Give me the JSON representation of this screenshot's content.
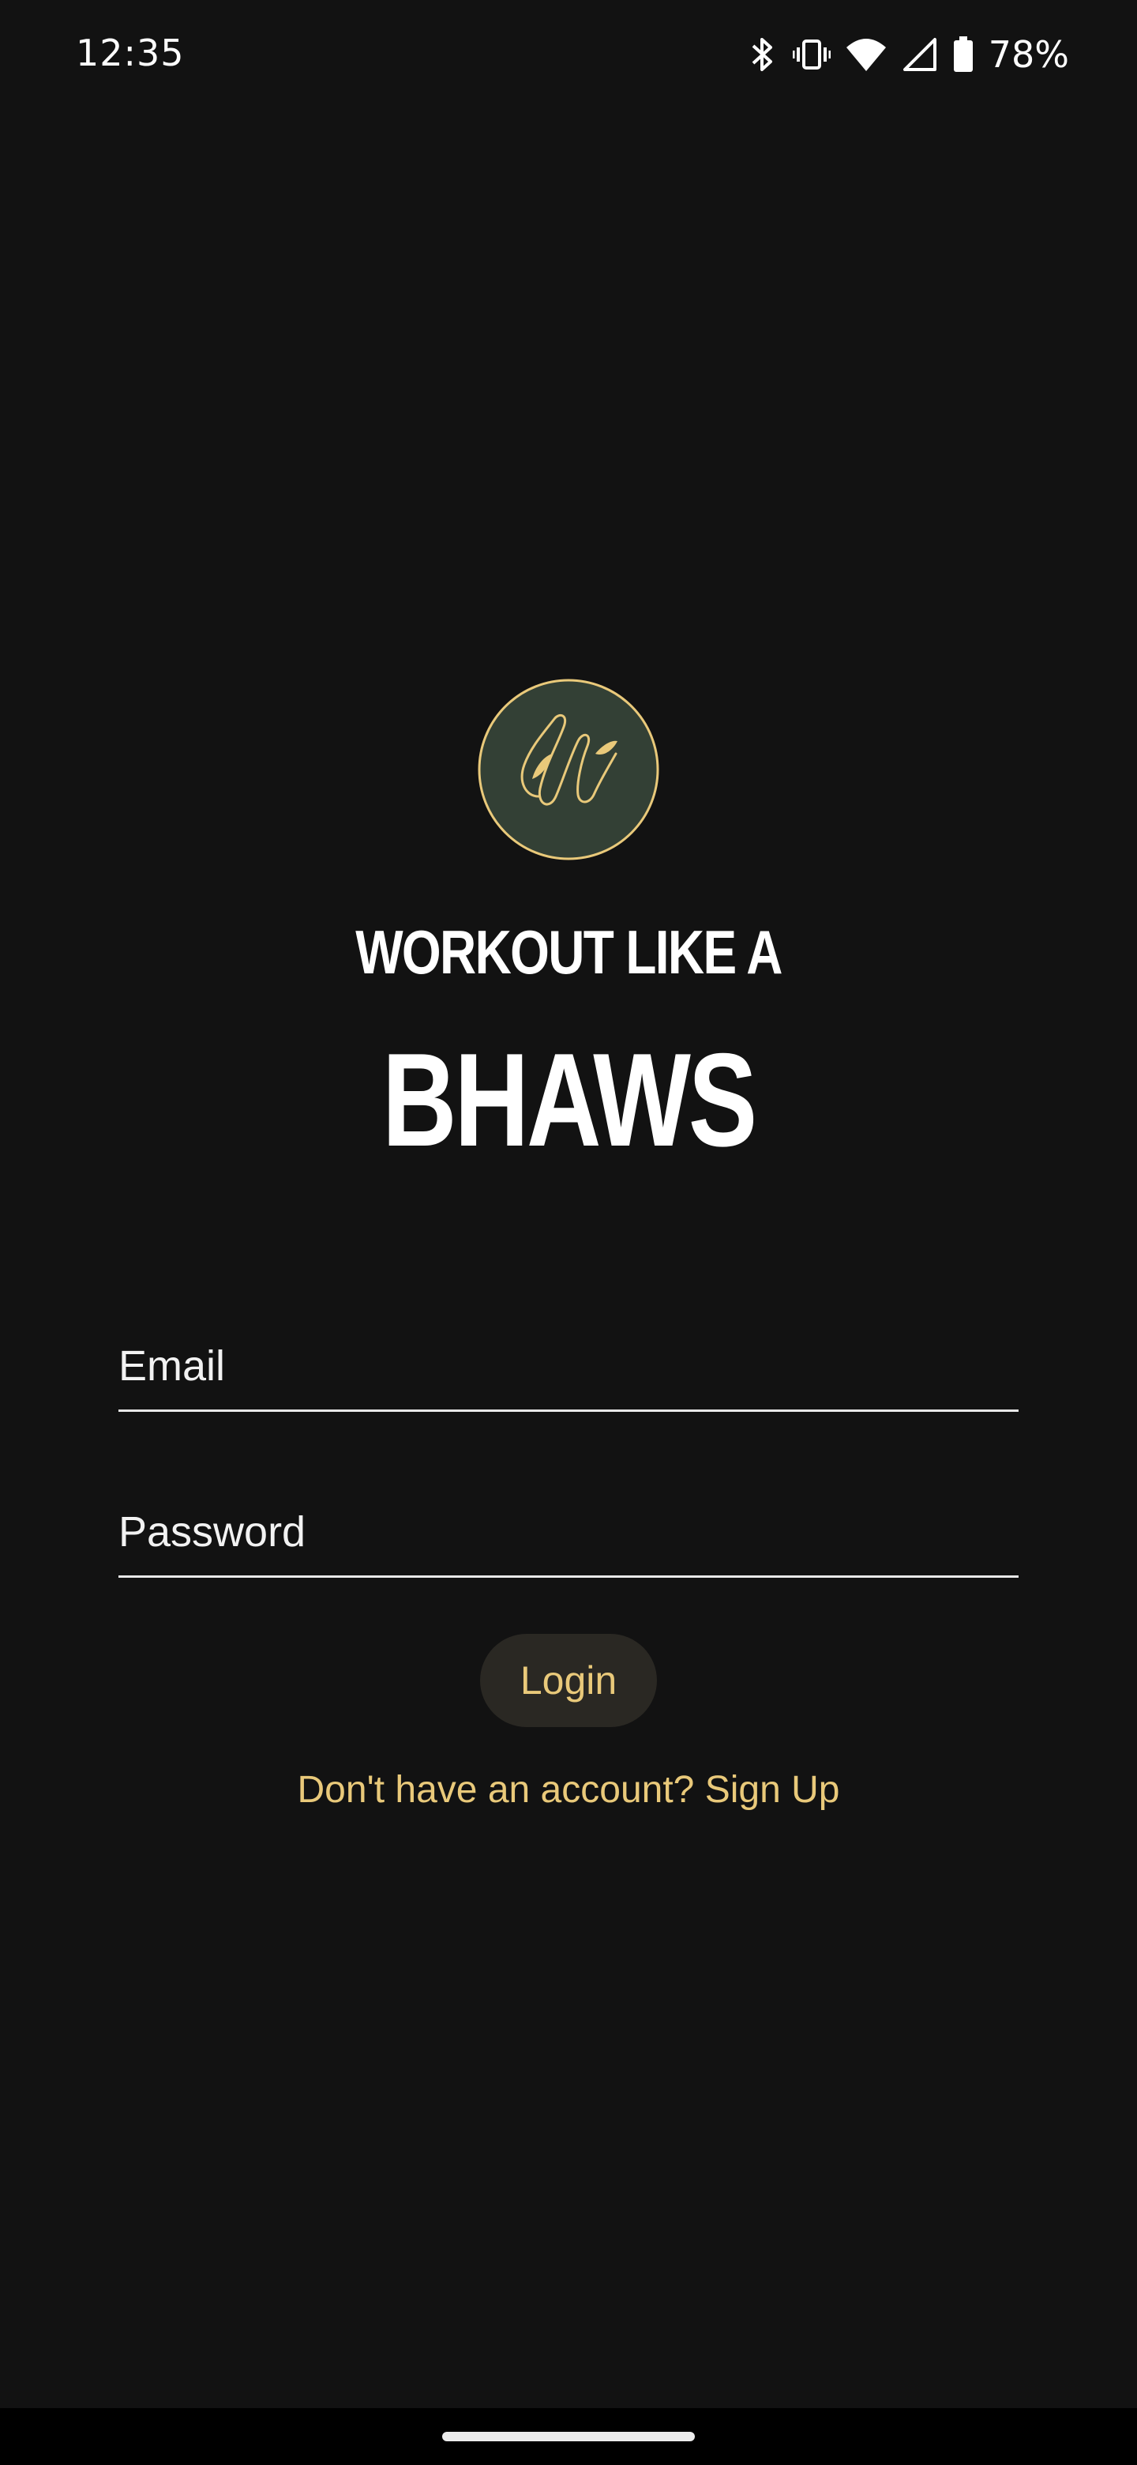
{
  "status_bar": {
    "time": "12:35",
    "battery": "78%",
    "icons": [
      "bluetooth-icon",
      "vibrate-icon",
      "wifi-icon",
      "signal-icon",
      "battery-icon"
    ]
  },
  "branding": {
    "logo_icon": "bhaws-logo-icon",
    "tagline": "WORKOUT LIKE A",
    "title": "BHAWS"
  },
  "form": {
    "email_placeholder": "Email",
    "email_value": "",
    "password_placeholder": "Password",
    "password_value": "",
    "login_label": "Login",
    "signup_text": "Don't have an account? Sign Up"
  },
  "colors": {
    "background": "#121212",
    "accent": "#e9c97a",
    "logo_fill": "#334035",
    "button_bg": "#2a2823"
  }
}
